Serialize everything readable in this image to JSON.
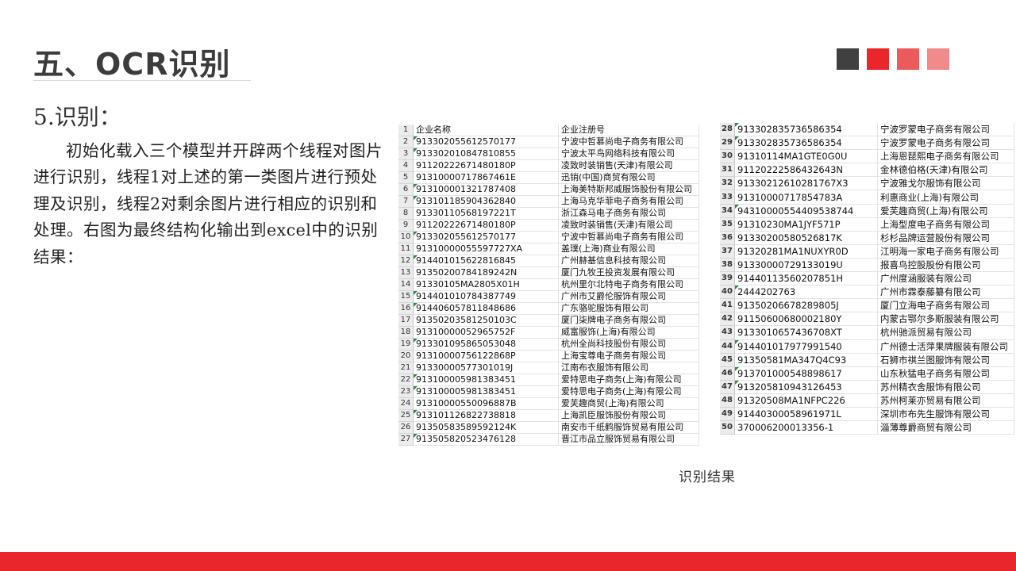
{
  "slide": {
    "title": "五、OCR识别",
    "subtitle": "5.识别：",
    "paragraph": "初始化载入三个模型并开辟两个线程对图片进行识别，线程1对上述的第一类图片进行预处理及识别，线程2对剩余图片进行相应的识别和处理。右图为最终结构化输出到excel中的识别结果：",
    "caption": "识别结果"
  },
  "colors": {
    "square1": "#404040",
    "square2": "#e8262b",
    "square3": "#ec5a5c",
    "square4": "#f08a8b",
    "footer": "#e8262b"
  },
  "sheet_left": {
    "rows": [
      {
        "n": "1",
        "code": "企业名称",
        "name": "企业注册号",
        "mark": false
      },
      {
        "n": "2",
        "code": "913302055612570177",
        "name": "宁波中哲慕尚电子商务有限公司",
        "mark": true
      },
      {
        "n": "3",
        "code": "913302010847810855",
        "name": "宁波太平鸟网络科技有限公司",
        "mark": true
      },
      {
        "n": "4",
        "code": "91120222671480180P",
        "name": "凌致时装销售(天津)有限公司",
        "mark": false
      },
      {
        "n": "5",
        "code": "91310000717867461E",
        "name": "迅销(中国)商贸有限公司",
        "mark": false
      },
      {
        "n": "6",
        "code": "913100001321787408",
        "name": "上海美特斯邦威服饰股份有限公司",
        "mark": true
      },
      {
        "n": "7",
        "code": "913101185904362840",
        "name": "上海马克华菲电子商务有限公司",
        "mark": true
      },
      {
        "n": "8",
        "code": "91330110568197221T",
        "name": "浙江森马电子商务有限公司",
        "mark": false
      },
      {
        "n": "9",
        "code": "91120222671480180P",
        "name": "凌致时装销售(天津)有限公司",
        "mark": false
      },
      {
        "n": "10",
        "code": "913302055612570177",
        "name": "宁波中哲慕尚电子商务有限公司",
        "mark": true
      },
      {
        "n": "11",
        "code": "91310000055597727XA",
        "name": "盖璞(上海)商业有限公司",
        "mark": false
      },
      {
        "n": "12",
        "code": "914401015622816845",
        "name": "广州赫基信息科技有限公司",
        "mark": true
      },
      {
        "n": "13",
        "code": "91350200784189242N",
        "name": "厦门九牧王投资发展有限公司",
        "mark": false
      },
      {
        "n": "14",
        "code": "91330105MA2805X01H",
        "name": "杭州里尔北特电子商务有限公司",
        "mark": false
      },
      {
        "n": "15",
        "code": "914401010784387749",
        "name": "广州市艾爵伦服饰有限公司",
        "mark": true
      },
      {
        "n": "16",
        "code": "914406057811848686",
        "name": "广东骆驼服饰有限公司",
        "mark": true
      },
      {
        "n": "17",
        "code": "91350203581250103C",
        "name": "厦门柒牌电子商务有限公司",
        "mark": false
      },
      {
        "n": "18",
        "code": "91310000052965752F",
        "name": "威富服饰(上海)有限公司",
        "mark": false
      },
      {
        "n": "19",
        "code": "913301095865053048",
        "name": "杭州全尚科技股份有限公司",
        "mark": true
      },
      {
        "n": "20",
        "code": "91310000756122868P",
        "name": "上海宝尊电子商务有限公司",
        "mark": false
      },
      {
        "n": "21",
        "code": "91330000577301019J",
        "name": "江南布衣服饰有限公司",
        "mark": false
      },
      {
        "n": "22",
        "code": "913100005981383451",
        "name": "爱特思电子商务(上海)有限公司",
        "mark": true
      },
      {
        "n": "23",
        "code": "913100005981383451",
        "name": "爱特思电子商务(上海)有限公司",
        "mark": true
      },
      {
        "n": "24",
        "code": "91310000550096887B",
        "name": "爱芙趣商贸(上海)有限公司",
        "mark": false
      },
      {
        "n": "25",
        "code": "913101126822738818",
        "name": "上海凯臣服饰股份有限公司",
        "mark": true
      },
      {
        "n": "26",
        "code": "91350583589592124K",
        "name": "南安市千纸鹤服饰贸易有限公司",
        "mark": false
      },
      {
        "n": "27",
        "code": "913505820523476128",
        "name": "晋江市品立服饰贸易有限公司",
        "mark": true
      }
    ]
  },
  "sheet_right": {
    "rows": [
      {
        "n": "28",
        "code": "913302835736586354",
        "name": "宁波罗蒙电子商务有限公司",
        "mark": true
      },
      {
        "n": "29",
        "code": "913302835736586354",
        "name": "宁波罗蒙电子商务有限公司",
        "mark": true
      },
      {
        "n": "30",
        "code": "91310114MA1GTE0G0U",
        "name": "上海恩琵熙电子商务有限公司",
        "mark": false
      },
      {
        "n": "31",
        "code": "91120222586432643N",
        "name": "金林德伯格(天津)有限公司",
        "mark": false
      },
      {
        "n": "32",
        "code": "91330212610281767X3",
        "name": "宁波雅戈尔服饰有限公司",
        "mark": false
      },
      {
        "n": "33",
        "code": "91310000717854783A",
        "name": "利惠商业(上海)有限公司",
        "mark": false
      },
      {
        "n": "34",
        "code": "94310000554409538744",
        "name": "爱芙趣商贸(上海)有限公司",
        "mark": true
      },
      {
        "n": "35",
        "code": "91310230MA1JYF571P",
        "name": "上海型度电子商务有限公司",
        "mark": false
      },
      {
        "n": "36",
        "code": "91330200580526817K",
        "name": "杉杉品牌运营股份有限公司",
        "mark": false
      },
      {
        "n": "37",
        "code": "91320281MA1NUXYR0D",
        "name": "江明海一家电子商务有限公司",
        "mark": false
      },
      {
        "n": "38",
        "code": "91330000729133019U",
        "name": "报喜鸟控股股份有限公司",
        "mark": false
      },
      {
        "n": "39",
        "code": "91440113560207851H",
        "name": "广州度涵服装有限公司",
        "mark": false
      },
      {
        "n": "40",
        "code": "2444202763",
        "name": "广州市霖泰藤纂有限公司",
        "mark": true
      },
      {
        "n": "41",
        "code": "91350206678289805J",
        "name": "厦门立海电子商务有限公司",
        "mark": false
      },
      {
        "n": "42",
        "code": "91150600680002180Y",
        "name": "内蒙古鄂尔多斯服装有限公司",
        "mark": false
      },
      {
        "n": "43",
        "code": "9133010657436708XT",
        "name": "杭州驰派贸易有限公司",
        "mark": false
      },
      {
        "n": "44",
        "code": "914401017977991540",
        "name": "广州德士活萍果牌服装有限公司",
        "mark": true
      },
      {
        "n": "45",
        "code": "91350581MA347Q4C93",
        "name": "石狮市祺兰图服饰有限公司",
        "mark": false
      },
      {
        "n": "46",
        "code": "913701000548898617",
        "name": "山东秋猛电子商务有限公司",
        "mark": true
      },
      {
        "n": "47",
        "code": "913205810943126453",
        "name": "苏州精衣舍服饰有限公司",
        "mark": true
      },
      {
        "n": "48",
        "code": "91320508MA1NFPC226",
        "name": "苏州柯莱亦贸易有限公司",
        "mark": false
      },
      {
        "n": "49",
        "code": "91440300058961971L",
        "name": "深圳市布先生服饰有限公司",
        "mark": false
      },
      {
        "n": "50",
        "code": "370006200013356-1",
        "name": "淄薄尊爵商贸有限公司",
        "mark": false
      }
    ]
  }
}
